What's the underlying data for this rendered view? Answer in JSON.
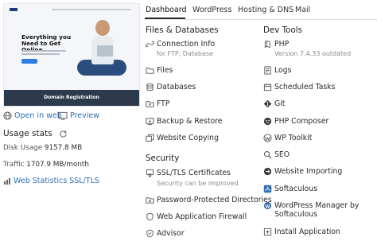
{
  "preview": {
    "headline": "Everything you Need to Get Online.",
    "footer_label": "Domain Registration"
  },
  "links": {
    "open_in_web": "Open in web",
    "preview": "Preview"
  },
  "usage": {
    "title": "Usage stats",
    "disk_label": "Disk Usage",
    "disk_value": "9157.8 MB",
    "traffic_label": "Traffic",
    "traffic_value": "1707.9 MB/month",
    "web_stats_label": "Web Statistics SSL/TLS"
  },
  "tabs": [
    "Dashboard",
    "WordPress",
    "Hosting & DNS",
    "Mail"
  ],
  "files_databases": {
    "title": "Files & Databases",
    "items": [
      {
        "label": "Connection Info",
        "sub": "for FTP, Database",
        "icon": "connection-icon"
      },
      {
        "label": "Files",
        "icon": "folder-icon"
      },
      {
        "label": "Databases",
        "icon": "database-icon"
      },
      {
        "label": "FTP",
        "icon": "ftp-folder-icon"
      },
      {
        "label": "Backup & Restore",
        "icon": "backup-icon"
      },
      {
        "label": "Website Copying",
        "icon": "copy-icon"
      }
    ]
  },
  "security": {
    "title": "Security",
    "items": [
      {
        "label": "SSL/TLS Certificates",
        "sub": "Security can be improved",
        "icon": "ssl-icon"
      },
      {
        "label": "Password-Protected Directories",
        "icon": "lock-folder-icon"
      },
      {
        "label": "Web Application Firewall",
        "icon": "firewall-icon"
      },
      {
        "label": "Advisor",
        "icon": "advisor-icon"
      }
    ]
  },
  "dev_tools": {
    "title": "Dev Tools",
    "items": [
      {
        "label": "PHP",
        "sub": "Version 7.4.33",
        "sub_status": "outdated",
        "icon": "php-icon"
      },
      {
        "label": "Logs",
        "icon": "logs-icon"
      },
      {
        "label": "Scheduled Tasks",
        "icon": "calendar-icon"
      },
      {
        "label": "Git",
        "icon": "git-icon"
      },
      {
        "label": "PHP Composer",
        "icon": "composer-icon"
      },
      {
        "label": "WP Toolkit",
        "icon": "wp-toolkit-icon"
      },
      {
        "label": "SEO",
        "icon": "seo-icon"
      },
      {
        "label": "Website Importing",
        "icon": "import-icon"
      },
      {
        "label": "Softaculous",
        "icon": "softaculous-icon"
      },
      {
        "label": "WordPress Manager by",
        "label2": "Softaculous",
        "icon": "wordpress-icon"
      },
      {
        "label": "Install Application",
        "icon": "install-icon"
      }
    ]
  },
  "colors": {
    "link": "#2f6fb8",
    "outdated": "#c0392b",
    "muted": "#8a8a8a"
  }
}
